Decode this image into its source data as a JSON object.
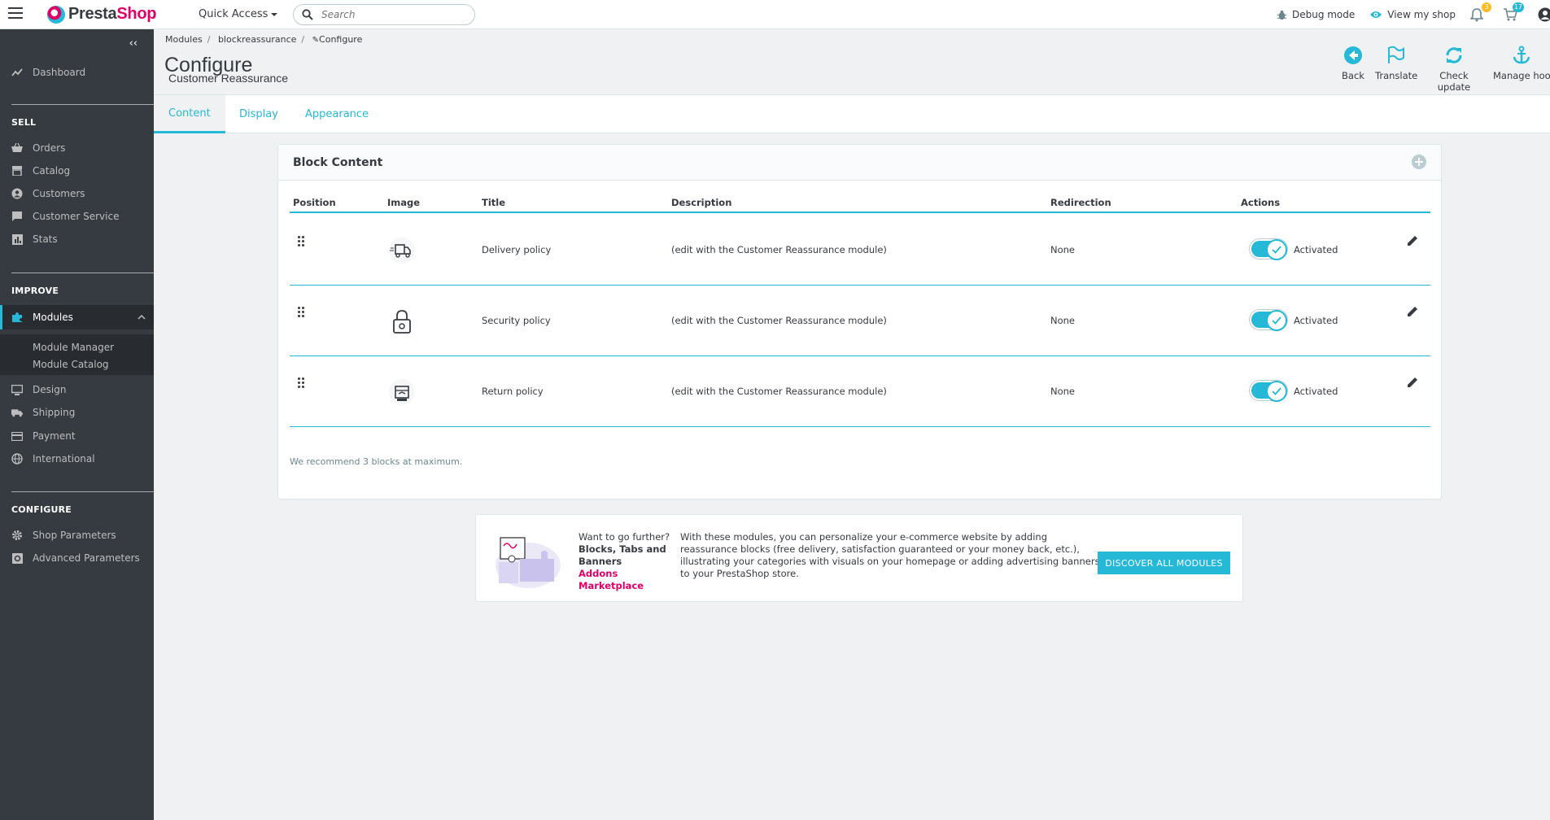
{
  "header": {
    "brand_presta": "Presta",
    "brand_shop": "Shop",
    "quick_access": "Quick Access",
    "search_placeholder": "Search",
    "debug_mode": "Debug mode",
    "view_my_shop": "View my shop",
    "notifications_badge": "3",
    "orders_badge": "17",
    "accent_color": "#25b9d7",
    "brand_color": "#df0067"
  },
  "sidebar": {
    "dashboard": "Dashboard",
    "sections": {
      "sell": "SELL",
      "improve": "IMPROVE",
      "configure": "CONFIGURE"
    },
    "sell_items": [
      "Orders",
      "Catalog",
      "Customers",
      "Customer Service",
      "Stats"
    ],
    "improve_items": [
      "Modules",
      "Design",
      "Shipping",
      "Payment",
      "International"
    ],
    "modules_submenu": [
      "Module Manager",
      "Module Catalog"
    ],
    "configure_items": [
      "Shop Parameters",
      "Advanced Parameters"
    ]
  },
  "breadcrumb": [
    "Modules",
    "blockreassurance",
    "Configure"
  ],
  "page": {
    "title": "Configure",
    "subtitle": "Customer Reassurance"
  },
  "toolbar": {
    "back": "Back",
    "translate": "Translate",
    "check_update": "Check update",
    "manage_hooks": "Manage hooks"
  },
  "tabs": [
    "Content",
    "Display",
    "Appearance"
  ],
  "panel": {
    "title": "Block Content",
    "columns": [
      "Position",
      "Image",
      "Title",
      "Description",
      "Redirection",
      "Actions"
    ],
    "rows": [
      {
        "title": "Delivery policy",
        "description": "(edit with the Customer Reassurance module)",
        "redirection": "None",
        "status": "Activated",
        "icon": "truck-icon"
      },
      {
        "title": "Security policy",
        "description": "(edit with the Customer Reassurance module)",
        "redirection": "None",
        "status": "Activated",
        "icon": "lock-icon"
      },
      {
        "title": "Return policy",
        "description": "(edit with the Customer Reassurance module)",
        "redirection": "None",
        "status": "Activated",
        "icon": "package-return-icon"
      }
    ],
    "recommendation": "We recommend 3 blocks at maximum."
  },
  "addons": {
    "want_further": "Want to go further?",
    "product": "Blocks, Tabs and Banners",
    "marketplace": "Addons Marketplace",
    "description": "With these modules, you can personalize your e-commerce website by adding reassurance blocks (free delivery, satisfaction guaranteed or your money back, etc.), illustrating your categories with visuals on your homepage or adding advertising banners to your PrestaShop store.",
    "button": "DISCOVER ALL MODULES"
  }
}
